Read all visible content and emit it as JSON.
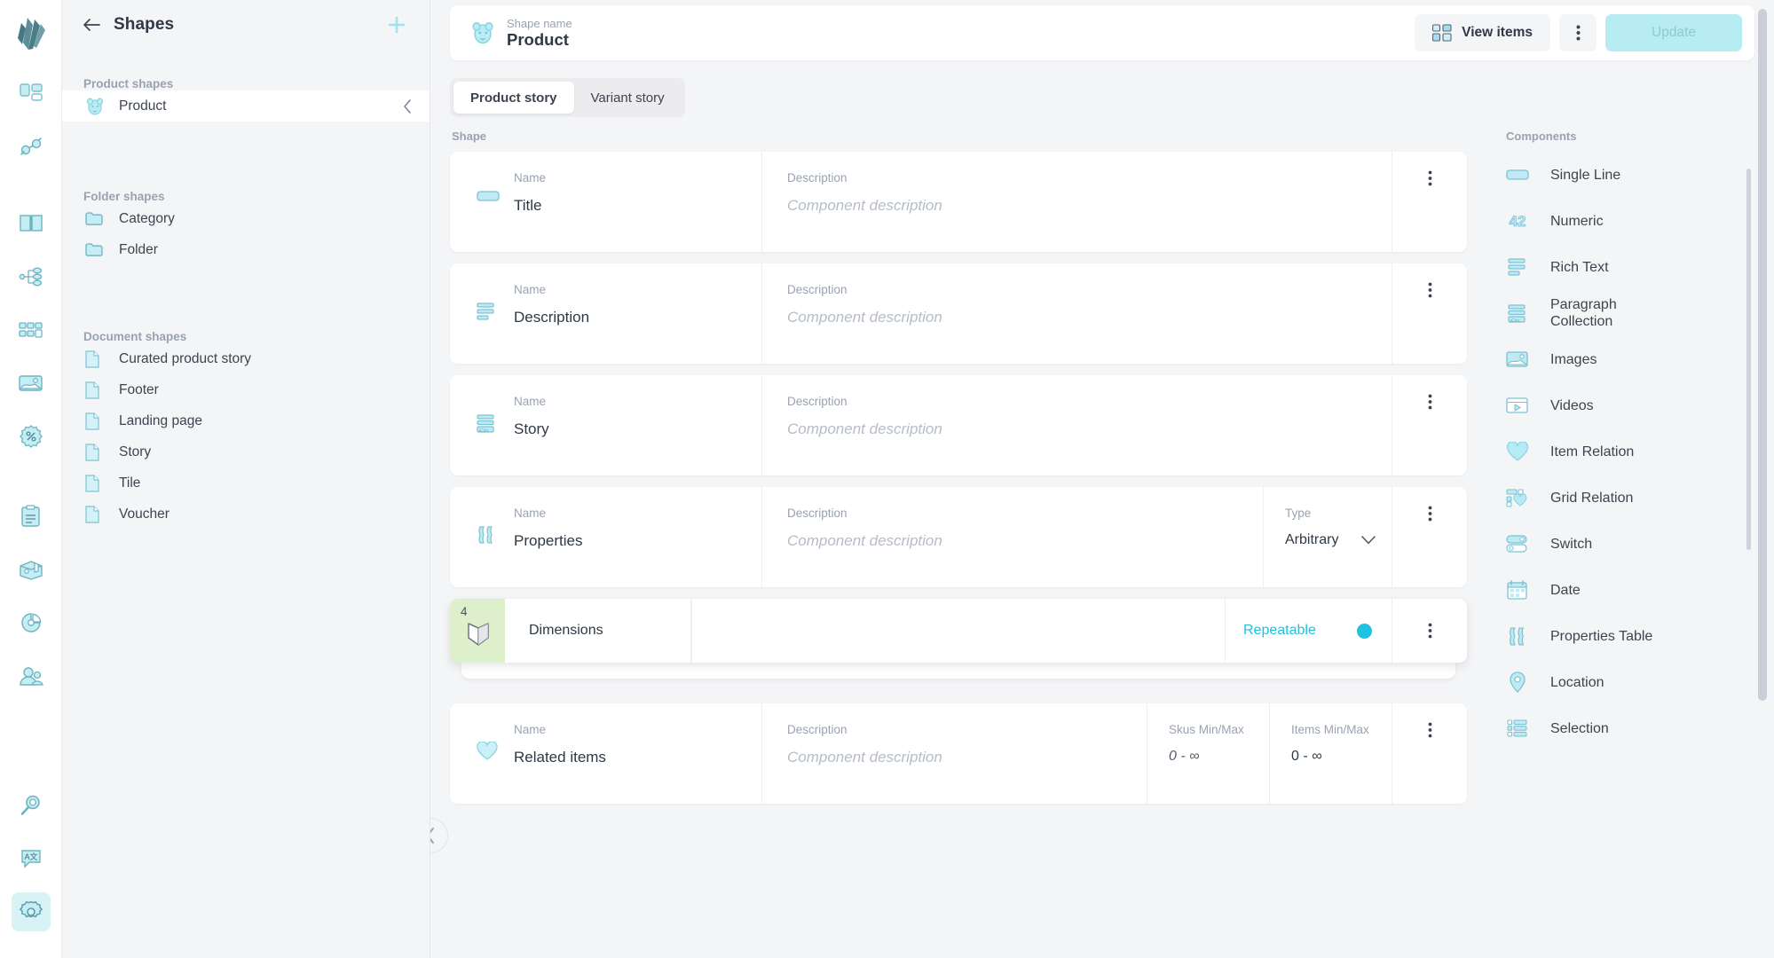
{
  "rail": {
    "logo": "crystallize-logo",
    "items": [
      {
        "name": "grid-layout-icon",
        "active": false
      },
      {
        "name": "plug-connection-icon",
        "active": false
      },
      {
        "name": "book-catalogue-icon",
        "active": false
      },
      {
        "name": "hierarchy-tree-icon",
        "active": false
      },
      {
        "name": "grid-blocks-icon",
        "active": false
      },
      {
        "name": "image-media-icon",
        "active": false
      },
      {
        "name": "discount-badge-icon",
        "active": false
      },
      {
        "name": "clipboard-orders-icon",
        "active": false
      },
      {
        "name": "box-shipment-icon",
        "active": false
      },
      {
        "name": "pie-chart-icon",
        "active": false
      },
      {
        "name": "customers-icon",
        "active": false
      }
    ],
    "bottom_items": [
      {
        "name": "search-icon",
        "active": false
      },
      {
        "name": "translate-icon",
        "active": false
      },
      {
        "name": "settings-gear-icon",
        "active": true
      }
    ]
  },
  "sidebar": {
    "back_label": "back-arrow",
    "title": "Shapes",
    "add_label": "add-shape",
    "groups": [
      {
        "label": "Product shapes",
        "items": [
          {
            "label": "Product",
            "icon": "product-pig-icon",
            "selected": true,
            "chevron": "‹"
          }
        ]
      },
      {
        "label": "Folder shapes",
        "items": [
          {
            "label": "Category",
            "icon": "folder-icon",
            "selected": false
          },
          {
            "label": "Folder",
            "icon": "folder-icon",
            "selected": false
          }
        ]
      },
      {
        "label": "Document shapes",
        "items": [
          {
            "label": "Curated product story",
            "icon": "document-icon",
            "selected": false
          },
          {
            "label": "Footer",
            "icon": "document-icon",
            "selected": false
          },
          {
            "label": "Landing page",
            "icon": "document-icon",
            "selected": false
          },
          {
            "label": "Story",
            "icon": "document-icon",
            "selected": false
          },
          {
            "label": "Tile",
            "icon": "document-icon",
            "selected": false
          },
          {
            "label": "Voucher",
            "icon": "document-icon",
            "selected": false
          }
        ]
      }
    ]
  },
  "topbar": {
    "shape_name_label": "Shape name",
    "shape_name_value": "Product",
    "view_items_label": "View items",
    "kebab_label": "more-options",
    "update_label": "Update"
  },
  "tabs": [
    {
      "label": "Product story",
      "active": true
    },
    {
      "label": "Variant story",
      "active": false
    }
  ],
  "shape": {
    "column_label": "Shape",
    "labels": {
      "name": "Name",
      "description": "Description",
      "type": "Type",
      "skus_minmax": "Skus Min/Max",
      "items_minmax": "Items Min/Max"
    },
    "description_placeholder": "Component description",
    "rows": [
      {
        "icon": "single-line-icon",
        "name": "Title",
        "description": "",
        "kebab": "row-menu"
      },
      {
        "icon": "rich-text-icon",
        "name": "Description",
        "description": "",
        "kebab": "row-menu"
      },
      {
        "icon": "paragraph-collection-icon",
        "name": "Story",
        "description": "",
        "kebab": "row-menu"
      },
      {
        "icon": "properties-table-icon",
        "name": "Properties",
        "description": "",
        "type_value": "Arbitrary",
        "kebab": "row-menu"
      }
    ],
    "dragging_row": {
      "badge_number": "4",
      "icon": "cube-3d-icon",
      "name": "Dimensions",
      "repeatable_label": "Repeatable",
      "repeatable_on": true,
      "kebab": "row-menu"
    },
    "related_row": {
      "icon": "item-relation-heart-icon",
      "name": "Related items",
      "description": "",
      "skus_min": "0",
      "skus_sep": "-",
      "skus_max": "∞",
      "items_min": "0",
      "items_sep": "-",
      "items_max": "∞",
      "kebab": "row-menu"
    }
  },
  "components": {
    "label": "Components",
    "items": [
      {
        "label": "Single Line",
        "icon": "single-line-icon"
      },
      {
        "label": "Numeric",
        "icon": "numeric-42-icon"
      },
      {
        "label": "Rich Text",
        "icon": "rich-text-icon"
      },
      {
        "label": "Paragraph\nCollection",
        "icon": "paragraph-collection-icon"
      },
      {
        "label": "Images",
        "icon": "images-icon"
      },
      {
        "label": "Videos",
        "icon": "videos-icon"
      },
      {
        "label": "Item Relation",
        "icon": "item-relation-heart-icon"
      },
      {
        "label": "Grid Relation",
        "icon": "grid-relation-icon"
      },
      {
        "label": "Switch",
        "icon": "switch-icon"
      },
      {
        "label": "Date",
        "icon": "date-calendar-icon"
      },
      {
        "label": "Properties Table",
        "icon": "properties-table-icon"
      },
      {
        "label": "Location",
        "icon": "location-pin-icon"
      },
      {
        "label": "Selection",
        "icon": "selection-list-icon"
      }
    ]
  },
  "collapse_handle": {
    "name": "collapse-panel-chevron"
  },
  "colors": {
    "accent_cyan": "#1fc1e0",
    "icon_teal": "#aee5ef",
    "update_disabled_bg": "#b6ecf2",
    "drag_green": "#ddefcb",
    "page_bg": "#f4f5f7"
  }
}
